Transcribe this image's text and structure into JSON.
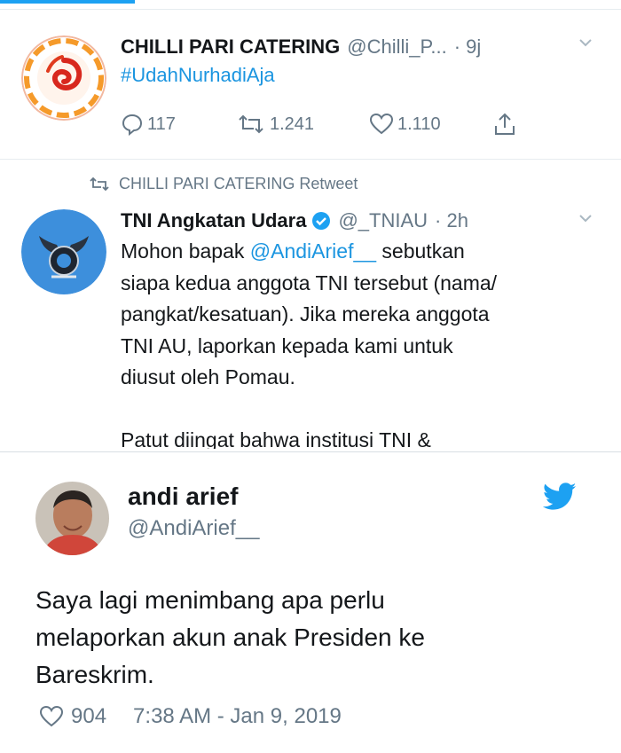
{
  "tweet_1": {
    "display_name": "CHILLI PARI CATERING",
    "handle": "@Chilli_P...",
    "time": "· 9j",
    "text": "#UdahNurhadiAja",
    "replies": "117",
    "retweets": "1.241",
    "likes": "1.110"
  },
  "retweet_context": {
    "text": "CHILLI PARI CATERING Retweet"
  },
  "tweet_2": {
    "display_name": "TNI Angkatan Udara",
    "handle": "@_TNIAU",
    "time": "· 2h",
    "lines": [
      {
        "pre": "Mohon bapak ",
        "mention": "@AndiArief__",
        "post": " sebutkan"
      },
      {
        "text": "siapa kedua anggota TNI tersebut (nama/"
      },
      {
        "text": "pangkat/kesatuan). Jika mereka anggota"
      },
      {
        "text": "TNI AU, laporkan kepada kami untuk"
      },
      {
        "text": "diusut oleh Pomau."
      },
      {
        "text": "Patut diingat bahwa institusi TNI &"
      }
    ]
  },
  "embedded_tweet": {
    "display_name": "andi arief",
    "handle": "@AndiArief__",
    "lines": [
      "Saya lagi menimbang apa perlu",
      "melaporkan akun anak Presiden ke",
      "Bareskrim."
    ],
    "likes": "904",
    "timestamp": "7:38 AM - Jan 9, 2019"
  },
  "colors": {
    "accent": "#1da1f2",
    "link": "#1b95e0",
    "muted": "#657786",
    "text": "#14171a",
    "divider": "#e6ecf0"
  },
  "icons": [
    "reply-icon",
    "retweet-icon",
    "like-icon",
    "share-icon",
    "chevron-down-icon",
    "verified-badge-icon",
    "twitter-bird-icon"
  ]
}
